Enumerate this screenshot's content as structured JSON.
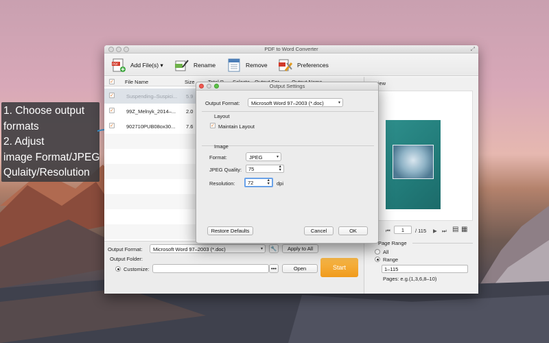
{
  "callout": {
    "lines": [
      "1. Choose output",
      "formats",
      "2. Adjust",
      "image Format/JPEG",
      "Qulaity/Resolution"
    ]
  },
  "window": {
    "title": "PDF to Word Converter"
  },
  "toolbar": {
    "add_files": "Add File(s)",
    "rename": "Rename",
    "remove": "Remove",
    "preferences": "Preferences"
  },
  "table": {
    "headers": [
      "File Name",
      "Size",
      "Total P...",
      "Selecte...",
      "Output For...",
      "Output Name"
    ],
    "rows": [
      {
        "name": "Suspending–Suspici...",
        "size": "5.9",
        "checked": true,
        "selected": true
      },
      {
        "name": "99Z_Melnyk_2014–...",
        "size": "2.0",
        "checked": true,
        "selected": false
      },
      {
        "name": "902710PUB08ox30...",
        "size": "7.6",
        "checked": true,
        "selected": false
      }
    ]
  },
  "bottom": {
    "output_format_label": "Output Format:",
    "output_format_value": "Microsoft Word 97–2003 (*.doc)",
    "apply_to_all": "Apply to All",
    "output_folder_label": "Output Folder:",
    "customize_label": "Customize:",
    "browse": "•••",
    "open": "Open",
    "start": "Start"
  },
  "preview": {
    "label": "view",
    "page_current": "1",
    "page_total": "/ 115",
    "page_range_label": "Page Range",
    "all_label": "All",
    "range_label": "Range",
    "range_value": "1–115",
    "pages_hint": "Pages: e.g.(1,3,6,8–10)"
  },
  "dialog": {
    "title": "Output Settings",
    "output_format_label": "Output Format:",
    "output_format_value": "Microsoft Word 97–2003 (*.doc)",
    "layout_label": "Layout",
    "maintain_layout": "Maintain Layout",
    "image_label": "Image",
    "format_label": "Format:",
    "format_value": "JPEG",
    "jpeg_quality_label": "JPEG Quality:",
    "jpeg_quality_value": "75",
    "resolution_label": "Resolution:",
    "resolution_value": "72",
    "dpi_label": "dpi",
    "restore_defaults": "Restore Defaults",
    "cancel": "Cancel",
    "ok": "OK"
  },
  "colors": {
    "accent_orange": "#f0a020",
    "focus_blue": "#6aa2e8",
    "selected_row": "#dde2e8"
  }
}
